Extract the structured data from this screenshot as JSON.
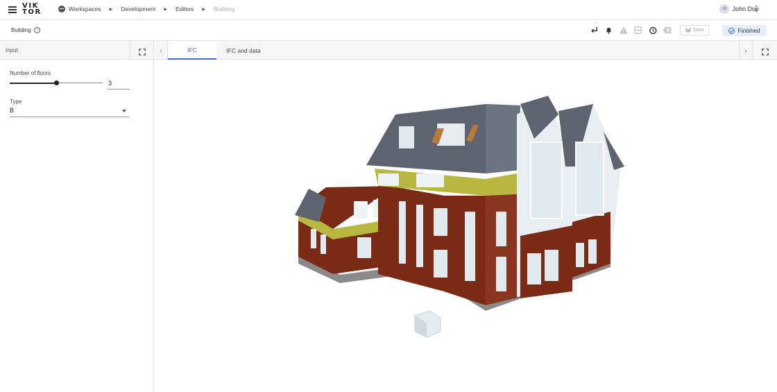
{
  "app": {
    "logo": "VIKTOR",
    "breadcrumbs": [
      "Workspaces",
      "Development",
      "Editors",
      "Building"
    ]
  },
  "user": {
    "initials": "JD",
    "name": "John Doe"
  },
  "entity": {
    "title": "Building"
  },
  "toolbar": {
    "save_label": "Save",
    "status_label": "Finished",
    "icons": [
      "enter-icon",
      "bell-icon",
      "warning-icon",
      "layout-icon",
      "history-icon",
      "clear-icon"
    ]
  },
  "input_panel": {
    "header": "Input",
    "fields": {
      "floors_label": "Number of floors",
      "floors_value": "3",
      "floors_fraction": 0.5,
      "type_label": "Type",
      "type_value": "B"
    }
  },
  "tabs": [
    {
      "label": "IFC",
      "active": true
    },
    {
      "label": "IFC and data",
      "active": false
    }
  ],
  "colors": {
    "accent": "#3b6ed6",
    "brick": "#7a2a15",
    "roof": "#5d6470",
    "accent_wall": "#b8b840",
    "glass": "#dfe9ee"
  }
}
